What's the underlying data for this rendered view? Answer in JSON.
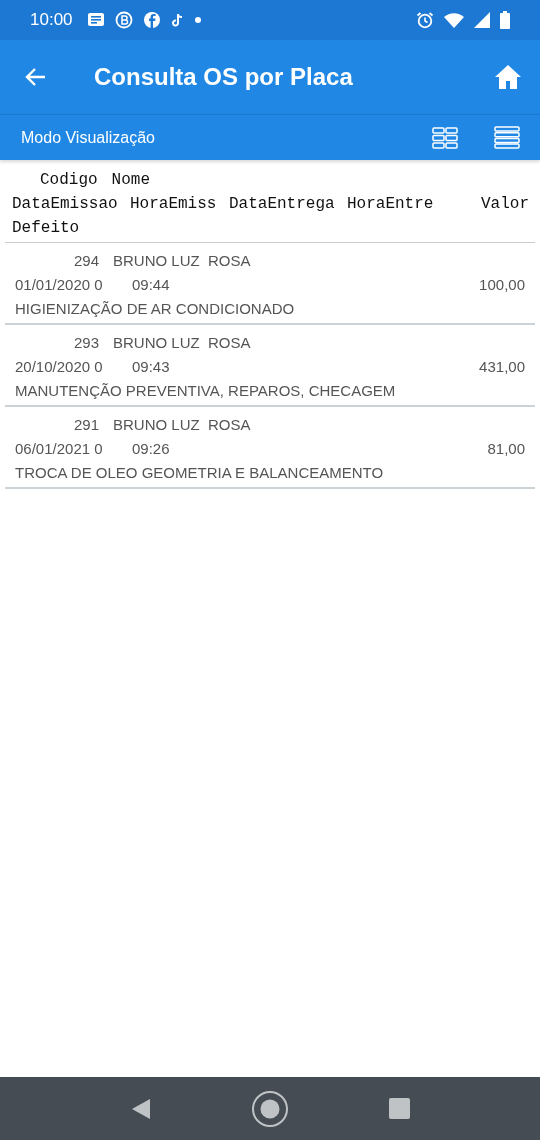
{
  "status_bar": {
    "time": "10:00"
  },
  "app_bar": {
    "title": "Consulta OS por Placa"
  },
  "toolbar": {
    "label": "Modo Visualização"
  },
  "header": {
    "line_1": [
      "Codigo",
      "Nome"
    ],
    "line_2": [
      "DataEmissao",
      "HoraEmiss",
      "DataEntrega",
      "HoraEntre",
      "Valor"
    ],
    "line_3": [
      "Defeito"
    ]
  },
  "rows": [
    {
      "codigo": "294",
      "nome": "BRUNO LUZ  ROSA",
      "data": "01/01/2020 0",
      "hora": "09:44",
      "valor": "100,00",
      "defeito": "HIGIENIZAÇÃO DE AR CONDICIONADO"
    },
    {
      "codigo": "293",
      "nome": "BRUNO LUZ  ROSA",
      "data": "20/10/2020 0",
      "hora": "09:43",
      "valor": "431,00",
      "defeito": "MANUTENÇÃO PREVENTIVA, REPAROS, CHECAGEM"
    },
    {
      "codigo": "291",
      "nome": "BRUNO LUZ  ROSA",
      "data": "06/01/2021 0",
      "hora": "09:26",
      "valor": "81,00",
      "defeito": "TROCA DE OLEO GEOMETRIA E BALANCEAMENTO"
    }
  ]
}
